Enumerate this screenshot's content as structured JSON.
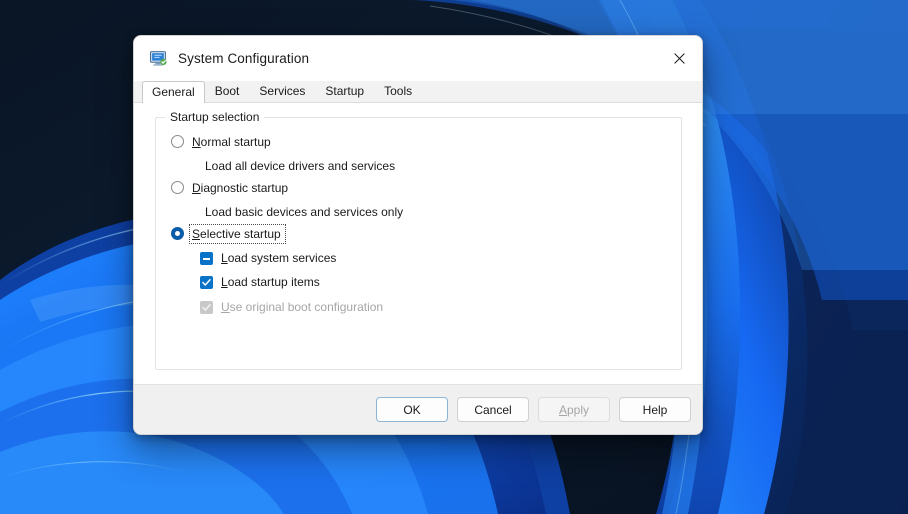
{
  "desktop": {
    "name": "windows-11-bloom-wallpaper"
  },
  "dialog": {
    "title": "System Configuration",
    "title_icon": "system-configuration-icon",
    "close_icon": "close-icon",
    "tabs": [
      {
        "label": "General",
        "active": true
      },
      {
        "label": "Boot",
        "active": false
      },
      {
        "label": "Services",
        "active": false
      },
      {
        "label": "Startup",
        "active": false
      },
      {
        "label": "Tools",
        "active": false
      }
    ],
    "group": {
      "legend": "Startup selection",
      "radios": [
        {
          "label": "Normal startup",
          "accel": "N",
          "rest": "ormal startup",
          "checked": false,
          "focused": false,
          "description": "Load all device drivers and services"
        },
        {
          "label": "Diagnostic startup",
          "accel": "D",
          "rest": "iagnostic startup",
          "checked": false,
          "focused": false,
          "description": "Load basic devices and services only"
        },
        {
          "label": "Selective startup",
          "accel": "S",
          "rest": "elective startup",
          "checked": true,
          "focused": true,
          "description": ""
        }
      ],
      "checkboxes": [
        {
          "label": "Load system services",
          "accel": "L",
          "rest": "oad system services",
          "state": "indeterminate",
          "enabled": true
        },
        {
          "label": "Load startup items",
          "accel": "L",
          "rest": "oad startup items",
          "state": "checked",
          "enabled": true
        },
        {
          "label": "Use original boot configuration",
          "accel": "U",
          "rest": "se original boot configuration",
          "state": "checked",
          "enabled": false
        }
      ]
    },
    "buttons": [
      {
        "label": "OK",
        "style": "default",
        "enabled": true
      },
      {
        "label": "Cancel",
        "style": "normal",
        "enabled": true
      },
      {
        "label": "Apply",
        "style": "disabled",
        "enabled": false,
        "accel": "A",
        "pre": "",
        "rest": "pply"
      },
      {
        "label": "Help",
        "style": "normal",
        "enabled": true
      }
    ]
  },
  "colors": {
    "accent_blue": "#0a73c8",
    "radio_blue": "#0a5ca8",
    "default_border": "#8bb6d8",
    "disabled_gray": "#a6a6a6",
    "wallpaper_dark": "#0c1a2b",
    "wallpaper_blue": "#1766e8"
  }
}
